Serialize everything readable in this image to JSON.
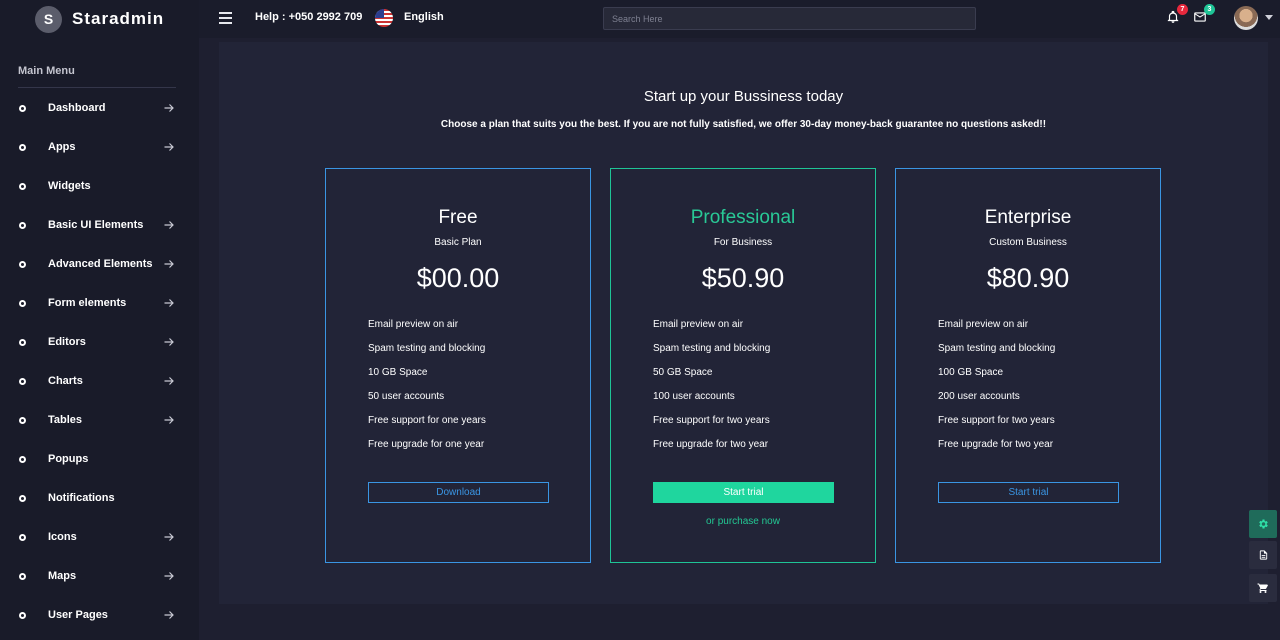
{
  "brand": {
    "logo_letter": "S",
    "name": "Staradmin"
  },
  "header": {
    "help_text": "Help : +050 2992 709",
    "language": "English",
    "search_placeholder": "Search Here",
    "notification_count": "7",
    "mail_count": "3",
    "icons": [
      "hamburger-icon",
      "us-flag-icon",
      "bell-icon",
      "mail-icon",
      "avatar"
    ]
  },
  "sidebar": {
    "title": "Main Menu",
    "items": [
      {
        "label": "Dashboard",
        "arrow": true
      },
      {
        "label": "Apps",
        "arrow": true
      },
      {
        "label": "Widgets",
        "arrow": false
      },
      {
        "label": "Basic UI Elements",
        "arrow": true
      },
      {
        "label": "Advanced Elements",
        "arrow": true
      },
      {
        "label": "Form elements",
        "arrow": true
      },
      {
        "label": "Editors",
        "arrow": true
      },
      {
        "label": "Charts",
        "arrow": true
      },
      {
        "label": "Tables",
        "arrow": true
      },
      {
        "label": "Popups",
        "arrow": false
      },
      {
        "label": "Notifications",
        "arrow": false
      },
      {
        "label": "Icons",
        "arrow": true
      },
      {
        "label": "Maps",
        "arrow": true
      },
      {
        "label": "User Pages",
        "arrow": true
      }
    ]
  },
  "main": {
    "heading": "Start up your Bussiness today",
    "subheading": "Choose a plan that suits you the best. If you are not fully satisfied, we offer 30-day money-back guarantee no questions asked!!",
    "plans": [
      {
        "name": "Free",
        "subtitle": "Basic Plan",
        "price": "$00.00",
        "features": [
          "Email preview on air",
          "Spam testing and blocking",
          "10 GB Space",
          "50 user accounts",
          "Free support for one years",
          "Free upgrade for one year"
        ],
        "button": "Download",
        "link": ""
      },
      {
        "name": "Professional",
        "subtitle": "For Business",
        "price": "$50.90",
        "features": [
          "Email preview on air",
          "Spam testing and blocking",
          "50 GB Space",
          "100 user accounts",
          "Free support for two years",
          "Free upgrade for two year"
        ],
        "button": "Start trial",
        "link": "or purchase now"
      },
      {
        "name": "Enterprise",
        "subtitle": "Custom Business",
        "price": "$80.90",
        "features": [
          "Email preview on air",
          "Spam testing and blocking",
          "100 GB Space",
          "200 user accounts",
          "Free support for two years",
          "Free upgrade for two year"
        ],
        "button": "Start trial",
        "link": ""
      }
    ]
  },
  "floating_toolbar": [
    "settings-icon",
    "file-icon",
    "cart-icon"
  ],
  "colors": {
    "background": "#1e1f30",
    "sidebar": "#191b29",
    "panel": "#222437",
    "accent_blue": "#3a95e3",
    "accent_green": "#1fd69e",
    "badge_red": "#e8283d",
    "badge_green": "#1fc496"
  }
}
